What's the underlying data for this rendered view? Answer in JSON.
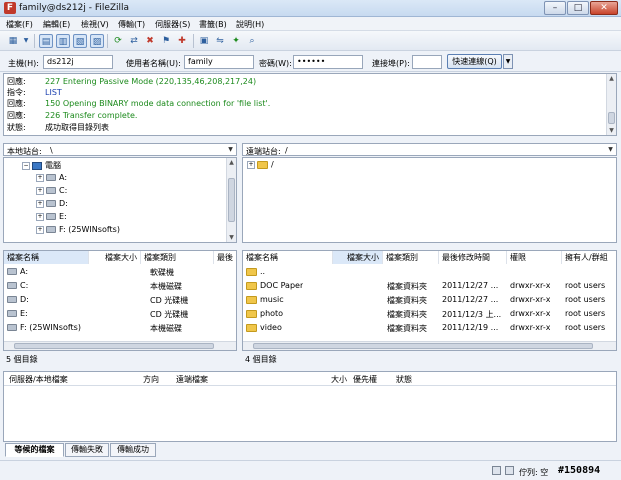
{
  "window": {
    "title": "family@ds212j - FileZilla",
    "min_glyph": "–",
    "max_glyph": "□",
    "close_glyph": "✕",
    "app_icon_glyph": "F"
  },
  "menu": [
    "檔案(F)",
    "編輯(E)",
    "檢視(V)",
    "傳輸(T)",
    "伺服器(S)",
    "書籤(B)",
    "說明(H)"
  ],
  "quickconnect": {
    "host_label": "主機(H):",
    "host_value": "ds212j",
    "user_label": "使用者名稱(U):",
    "user_value": "family",
    "pass_label": "密碼(W):",
    "pass_value": "••••••",
    "port_label": "連接埠(P):",
    "port_value": "",
    "button_label": "快速連線(Q)",
    "drop_glyph": "▼"
  },
  "log": [
    {
      "label": "回應:",
      "text": "227 Entering Passive Mode (220,135,46,208,217,24)",
      "color": "grn"
    },
    {
      "label": "指令:",
      "text": "LIST",
      "color": "blu"
    },
    {
      "label": "回應:",
      "text": "150 Opening BINARY mode data connection for 'file list'.",
      "color": "grn"
    },
    {
      "label": "回應:",
      "text": "226 Transfer complete.",
      "color": "grn"
    },
    {
      "label": "狀態:",
      "text": "成功取得目錄列表",
      "color": "none"
    }
  ],
  "local": {
    "site_label": "本地站台:",
    "path": "\\",
    "tree": [
      {
        "label": "電腦",
        "kind": "pc",
        "expander": "−"
      },
      {
        "label": "A:",
        "kind": "drive",
        "expander": "+"
      },
      {
        "label": "C:",
        "kind": "drive",
        "expander": "+"
      },
      {
        "label": "D:",
        "kind": "drive",
        "expander": "+"
      },
      {
        "label": "E:",
        "kind": "drive",
        "expander": "+"
      },
      {
        "label": "F: (25WINsofts)",
        "kind": "drive",
        "expander": "+"
      }
    ],
    "columns": [
      "檔案名稱",
      "檔案大小",
      "檔案類別",
      "最後"
    ],
    "files": [
      {
        "name": "A:",
        "size": "",
        "type": "軟碟機"
      },
      {
        "name": "C:",
        "size": "",
        "type": "本機磁碟"
      },
      {
        "name": "D:",
        "size": "",
        "type": "CD 光碟機"
      },
      {
        "name": "E:",
        "size": "",
        "type": "CD 光碟機"
      },
      {
        "name": "F: (25WINsofts)",
        "size": "",
        "type": "本機磁碟"
      }
    ],
    "status": "5 個目錄"
  },
  "remote": {
    "site_label": "遠端站台:",
    "path": "/",
    "tree": [
      {
        "label": "/",
        "kind": "folder",
        "expander": "+"
      }
    ],
    "columns": [
      "檔案名稱",
      "檔案大小",
      "檔案類別",
      "最後修改時間",
      "權限",
      "擁有人/群組"
    ],
    "files": [
      {
        "name": "..",
        "size": "",
        "type": "",
        "modified": "",
        "perms": "",
        "owner": ""
      },
      {
        "name": "DOC Paper",
        "size": "",
        "type": "檔案資料夾",
        "modified": "2011/12/27 ...",
        "perms": "drwxr-xr-x",
        "owner": "root users"
      },
      {
        "name": "music",
        "size": "",
        "type": "檔案資料夾",
        "modified": "2011/12/27 ...",
        "perms": "drwxr-xr-x",
        "owner": "root users"
      },
      {
        "name": "photo",
        "size": "",
        "type": "檔案資料夾",
        "modified": "2011/12/3 上...",
        "perms": "drwxr-xr-x",
        "owner": "root users"
      },
      {
        "name": "video",
        "size": "",
        "type": "檔案資料夾",
        "modified": "2011/12/19 ...",
        "perms": "drwxr-xr-x",
        "owner": "root users"
      }
    ],
    "status": "4 個目錄"
  },
  "queue": {
    "columns": [
      "伺服器/本地檔案",
      "方向",
      "遠端檔案",
      "大小",
      "優先權",
      "狀態"
    ],
    "tabs": [
      "等候的檔案",
      "傳輸失敗",
      "傳輸成功"
    ],
    "status": "佇列: 空"
  },
  "watermark": "#150894",
  "colors": {
    "accent": "#3b78c4",
    "log_green": "#1c8a1c",
    "log_blue": "#1a3fb0",
    "close_red": "#c8432b"
  }
}
